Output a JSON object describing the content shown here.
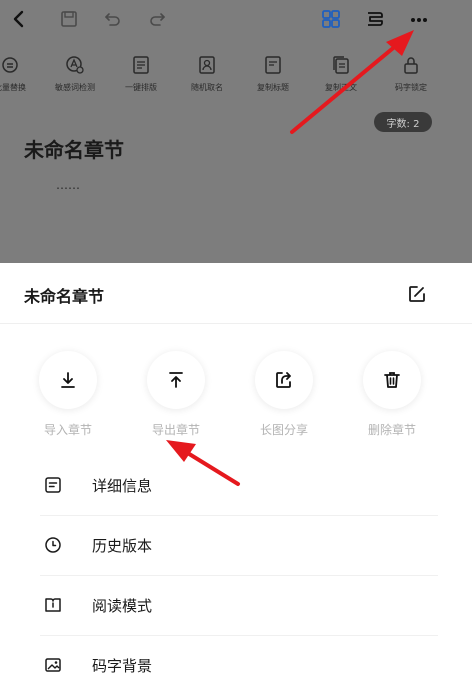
{
  "editor": {
    "chapter_title": "未命名章节",
    "chapter_body": "……",
    "word_count": "字数: 2",
    "tools": [
      {
        "label": "批量替换",
        "icon": "replace-icon"
      },
      {
        "label": "敏感词检测",
        "icon": "sensitive-check-icon"
      },
      {
        "label": "一键排版",
        "icon": "format-icon"
      },
      {
        "label": "随机取名",
        "icon": "random-name-icon"
      },
      {
        "label": "复制标题",
        "icon": "copy-title-icon"
      },
      {
        "label": "复制正文",
        "icon": "copy-text-icon"
      },
      {
        "label": "码字锁定",
        "icon": "lock-icon"
      }
    ]
  },
  "sheet": {
    "title": "未命名章节",
    "actions": [
      {
        "label": "导入章节",
        "icon": "import-icon"
      },
      {
        "label": "导出章节",
        "icon": "export-icon"
      },
      {
        "label": "长图分享",
        "icon": "share-icon"
      },
      {
        "label": "删除章节",
        "icon": "trash-icon"
      }
    ],
    "items": [
      {
        "label": "详细信息",
        "icon": "details-icon"
      },
      {
        "label": "历史版本",
        "icon": "history-icon"
      },
      {
        "label": "阅读模式",
        "icon": "reading-mode-icon"
      },
      {
        "label": "码字背景",
        "icon": "background-image-icon"
      }
    ]
  },
  "colors": {
    "overlay": "#7d7d7d",
    "accent_blue": "#2f6fd8",
    "annotation_red": "#e5191e",
    "action_label": "#b3b3b3"
  }
}
